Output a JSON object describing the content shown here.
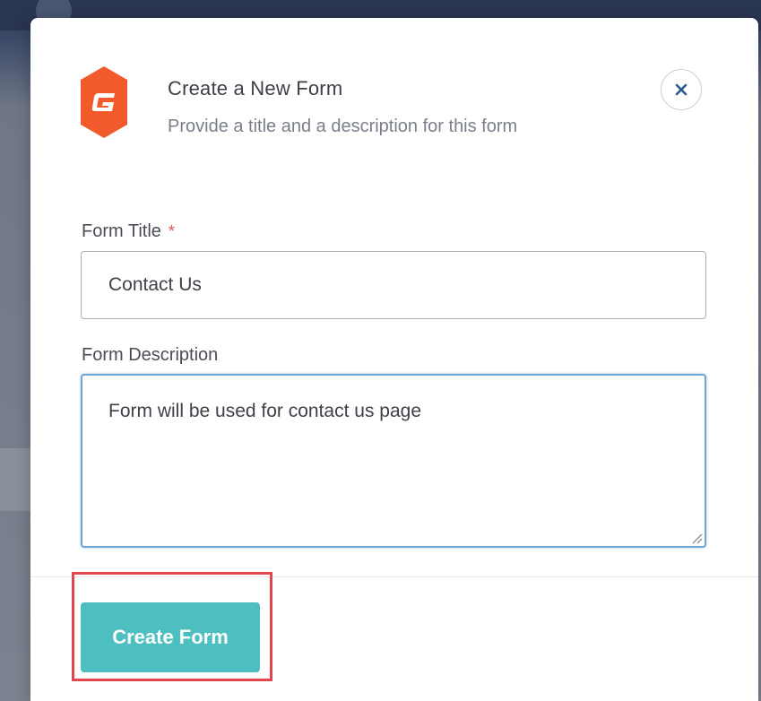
{
  "modal": {
    "title": "Create a New Form",
    "subtitle": "Provide a title and a description for this form",
    "close_icon": "close-icon",
    "logo_icon": "gravity-forms-logo",
    "brand_color": "#f15a2b"
  },
  "form": {
    "title_label": "Form Title",
    "required_mark": "*",
    "title_value": "Contact Us",
    "description_label": "Form Description",
    "description_value": "Form will be used for contact us page"
  },
  "footer": {
    "create_label": "Create Form",
    "button_color": "#4dbfc0",
    "highlight_color": "#e2474d"
  }
}
